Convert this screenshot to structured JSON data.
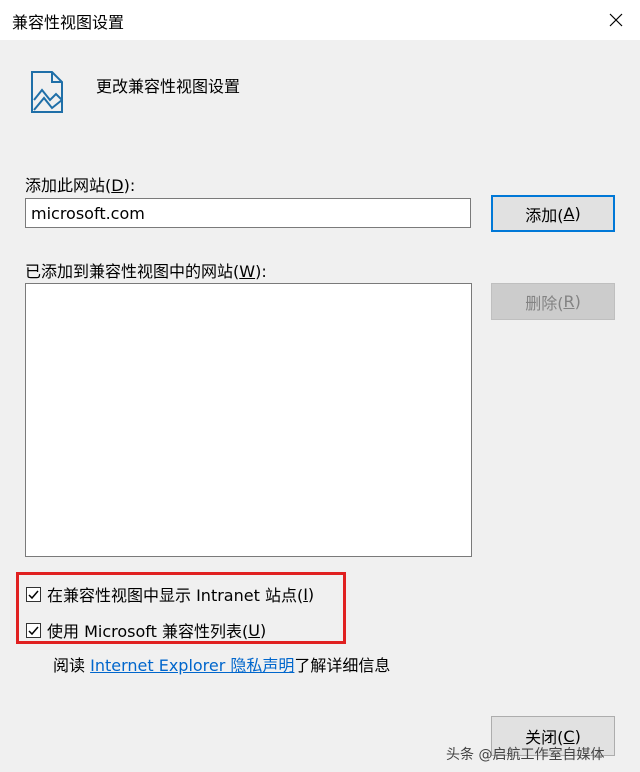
{
  "window": {
    "title": "兼容性视图设置"
  },
  "header": {
    "text": "更改兼容性视图设置",
    "icon": "picture-icon"
  },
  "add_site": {
    "label": "添加此网站(",
    "accesskey": "D",
    "label_suffix": "):",
    "value": "microsoft.com",
    "button_label": "添加(",
    "button_accesskey": "A",
    "button_suffix": ")"
  },
  "site_list": {
    "label": "已添加到兼容性视图中的网站(",
    "accesskey": "W",
    "label_suffix": "):",
    "items": [],
    "remove_label": "删除(",
    "remove_accesskey": "R",
    "remove_suffix": ")"
  },
  "options": [
    {
      "label": "在兼容性视图中显示 Intranet 站点(",
      "accesskey": "I",
      "suffix": ")",
      "checked": true
    },
    {
      "label": "使用 Microsoft 兼容性列表(",
      "accesskey": "U",
      "suffix": ")",
      "checked": true
    }
  ],
  "info": {
    "prefix": "阅读 ",
    "link": "Internet Explorer 隐私声明",
    "suffix": "了解详细信息"
  },
  "close_button": {
    "label": "关闭(",
    "accesskey": "C",
    "suffix": ")"
  },
  "watermark": "头条 @启航工作室自媒体",
  "colors": {
    "accent": "#0078d7",
    "highlight": "#e02020",
    "link": "#0066cc"
  }
}
